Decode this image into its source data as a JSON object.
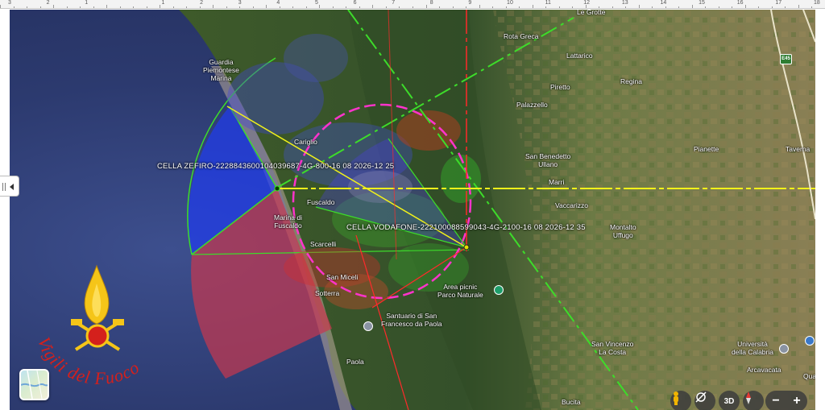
{
  "ruler": {
    "numbers": [
      "3",
      "2",
      "1",
      "",
      "1",
      "2",
      "3",
      "4",
      "5",
      "6",
      "7",
      "8",
      "9",
      "10",
      "11",
      "12",
      "13",
      "14",
      "15",
      "16",
      "17",
      "18"
    ]
  },
  "map": {
    "places": [
      {
        "name": "Guardia\nPiemontese\nMarina",
        "id": "guardia"
      },
      {
        "name": "Le Grotte",
        "id": "le-grotte"
      },
      {
        "name": "Rota Greca",
        "id": "rota-greca"
      },
      {
        "name": "Lattarico",
        "id": "lattarico"
      },
      {
        "name": "Regina",
        "id": "regina"
      },
      {
        "name": "Piretto",
        "id": "piretto"
      },
      {
        "name": "Palazzello",
        "id": "palazzello"
      },
      {
        "name": "Cariglio",
        "id": "cariglio"
      },
      {
        "name": "San Benedetto\nUllano",
        "id": "san-benedetto"
      },
      {
        "name": "Pianette",
        "id": "pianette"
      },
      {
        "name": "Taverna",
        "id": "taverna"
      },
      {
        "name": "Marri",
        "id": "marri"
      },
      {
        "name": "Fuscaldo",
        "id": "fuscaldo"
      },
      {
        "name": "Vaccarizzo",
        "id": "vaccarizzo"
      },
      {
        "name": "Marina di\nFuscaldo",
        "id": "marina-fuscaldo"
      },
      {
        "name": "Montalto\nUffugo",
        "id": "montalto"
      },
      {
        "name": "Scarcelli",
        "id": "scarcelli"
      },
      {
        "name": "San Miceli",
        "id": "san-miceli"
      },
      {
        "name": "Area picnic\nParco Naturale",
        "id": "area-picnic"
      },
      {
        "name": "Sotterra",
        "id": "sotterra"
      },
      {
        "name": "Santuario di San\nFrancesco da Paola",
        "id": "santuario"
      },
      {
        "name": "San Vincenzo\nLa Costa",
        "id": "san-vincenzo"
      },
      {
        "name": "Università\ndella Calabria",
        "id": "unical"
      },
      {
        "name": "Arcavacata",
        "id": "arcavacata"
      },
      {
        "name": "Paola",
        "id": "paola"
      },
      {
        "name": "Bucita",
        "id": "bucita"
      },
      {
        "name": "Qua",
        "id": "qua"
      }
    ],
    "cells": [
      {
        "id": "zefiro",
        "label": "CELLA ZEFIRO-222884360010403968​7-4G-800-16 08 2026-12 25",
        "sector_color": "#1d2fd6",
        "beam_color": "#ffff00",
        "accent": "#39d12b"
      },
      {
        "id": "vodafone",
        "label": "CELLA VODAFONE-222100088599043-4G-2100-16 08 2026-12 35",
        "sector_color": "#e8158c",
        "beam_color": "#e0e000",
        "accent": "#ff2a2a"
      }
    ],
    "road_shield": "E45",
    "colors": {
      "sea": "#31407a",
      "land": "#5d6b37",
      "hills": "#3f5a2a",
      "sector_blue": "#1f3cf0",
      "sector_red": "#c8384f",
      "green_line": "#3ddc2a",
      "yellow_line": "#f2f21a",
      "magenta": "#ff33cc"
    }
  },
  "controls": {
    "street_view_icon": "pegman-icon",
    "rotate_icon": "rotate-view-icon",
    "three_d": "3D",
    "compass_icon": "compass-icon",
    "zoom_out": "−",
    "zoom_in": "+",
    "layers_icon": "layers-thumbnail-icon",
    "collapse_icon": "chevron-left-icon"
  },
  "logo": {
    "text": "Vigili del Fuoco",
    "colors": {
      "flame": "#f5c518",
      "red": "#d4201c"
    }
  }
}
